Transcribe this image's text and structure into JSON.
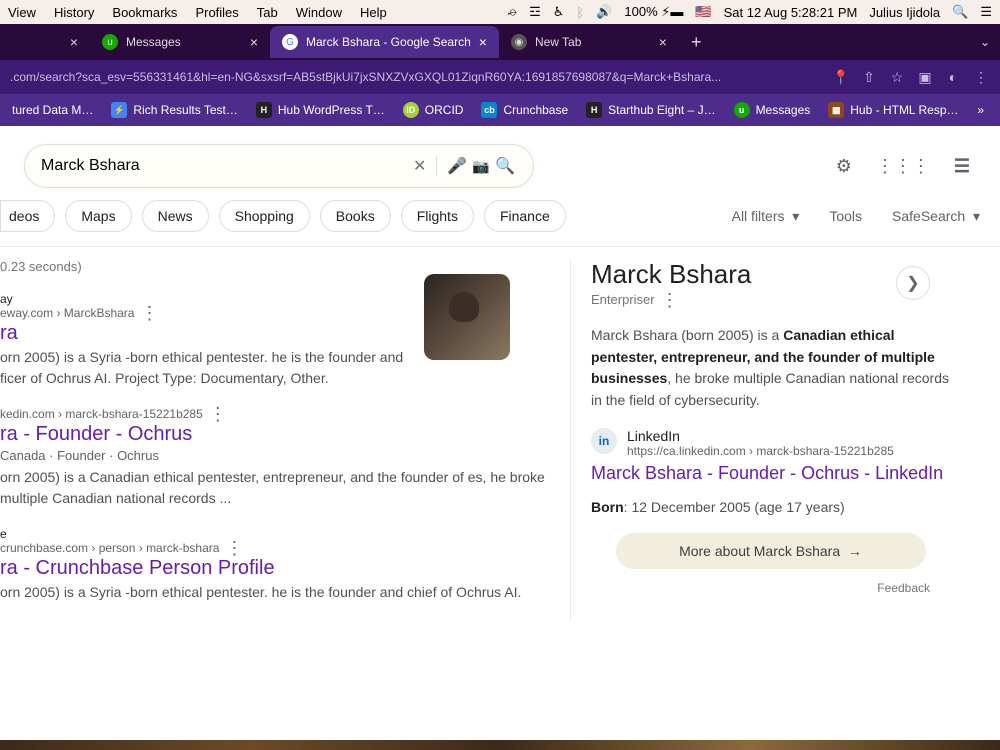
{
  "menubar": {
    "left": [
      "View",
      "History",
      "Bookmarks",
      "Profiles",
      "Tab",
      "Window",
      "Help"
    ],
    "battery": "100%",
    "flag": "🇺🇸",
    "datetime": "Sat 12 Aug  5:28:21 PM",
    "user": "Julius Ijidola"
  },
  "tabs": {
    "t0_close": "×",
    "t1_label": "Messages",
    "t1_close": "×",
    "t2_label": "Marck Bshara - Google Search",
    "t2_close": "×",
    "t3_label": "New Tab",
    "t3_close": "×",
    "newtab": "+"
  },
  "address": {
    "url": ".com/search?sca_esv=556331461&hl=en-NG&sxsrf=AB5stBjkUi7jxSNXZVxGXQL01ZiqnR60YA:1691857698087&q=Marck+Bshara..."
  },
  "bookmarks": {
    "b0": "tured Data M…",
    "b1": "Rich Results Test…",
    "b2": "Hub WordPress T…",
    "b3": "ORCID",
    "b4": "Crunchbase",
    "b5": "Starthub Eight – J…",
    "b6": "Messages",
    "b7": "Hub - HTML Resp…"
  },
  "search": {
    "query": "Marck Bshara"
  },
  "chips": [
    "deos",
    "Maps",
    "News",
    "Shopping",
    "Books",
    "Flights",
    "Finance"
  ],
  "filters": {
    "all": "All filters",
    "tools": "Tools",
    "safe": "SafeSearch"
  },
  "stats": "0.23 seconds)",
  "results": {
    "r0": {
      "site": "ay",
      "crumb": "eway.com › MarckBshara",
      "title": "ra",
      "desc": "orn 2005) is a Syria -born ethical pentester. he is the founder and ficer of Ochrus AI. Project Type: Documentary, Other."
    },
    "r1": {
      "crumb": "kedin.com › marck-bshara-15221b285",
      "title": "ra - Founder - Ochrus",
      "sub": "Canada · Founder · Ochrus",
      "desc": "orn 2005) is a Canadian ethical pentester, entrepreneur, and the founder of es, he broke multiple Canadian national records ..."
    },
    "r2": {
      "site": "e",
      "crumb": "crunchbase.com › person › marck-bshara",
      "title": "ra - Crunchbase Person Profile",
      "desc": "orn 2005) is a Syria -born ethical pentester. he is the founder and chief of Ochrus AI."
    }
  },
  "kp": {
    "title": "Marck Bshara",
    "subtitle": "Enterpriser",
    "desc_pre": "Marck Bshara (born 2005) is a ",
    "desc_bold": "Canadian ethical pentester, entrepreneur, and the founder of multiple businesses",
    "desc_post": ", he broke multiple Canadian national records in the field of cybersecurity.",
    "li_name": "LinkedIn",
    "li_url": "https://ca.linkedin.com › marck-bshara-15221b285",
    "li_link": "Marck Bshara - Founder - Ochrus - LinkedIn",
    "born_label": "Born",
    "born_val": ": 12 December 2005 (age 17 years)",
    "more": "More about Marck Bshara",
    "feedback": "Feedback"
  }
}
